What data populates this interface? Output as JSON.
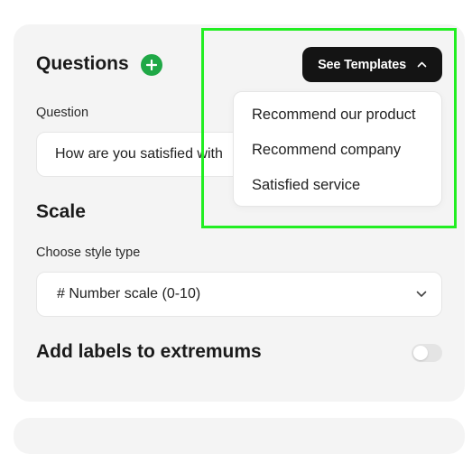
{
  "questions": {
    "title": "Questions",
    "add_icon": "plus-icon",
    "accent_color": "#1fa846"
  },
  "templates": {
    "button_label": "See Templates",
    "toggle_icon": "chevron-up-icon",
    "items": [
      "Recommend our product",
      "Recommend company",
      "Satisfied service"
    ]
  },
  "question": {
    "label": "Question",
    "value": "How are you satisfied with"
  },
  "scale": {
    "title": "Scale",
    "style_label": "Choose style type",
    "selected_style": "# Number scale (0-10)",
    "dropdown_icon": "chevron-down-icon"
  },
  "extremums": {
    "label": "Add labels to extremums",
    "enabled": false
  },
  "highlight_color": "#22ee22"
}
